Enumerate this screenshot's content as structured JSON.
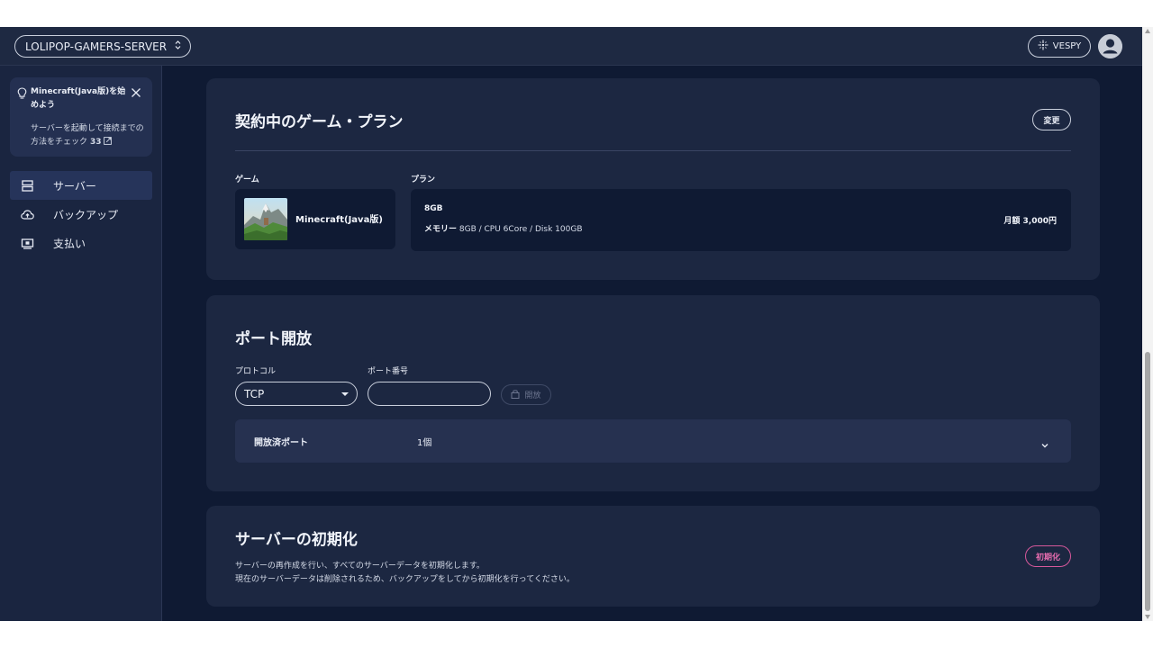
{
  "topbar": {
    "server_name": "LOLIPOP-GAMERS-SERVER",
    "user_button_label": "VESPY",
    "icons": {
      "server_select": "updown-chevron-icon",
      "user_button": "sparkle-icon",
      "avatar": "user-avatar-icon"
    }
  },
  "sidebar": {
    "tip": {
      "title": "Minecraft(Java版)を始めよう",
      "body": "サーバーを起動して接続までの方法をチェック",
      "link_badge": "33",
      "icons": {
        "bulb": "lightbulb-icon",
        "close": "close-icon",
        "link": "external-link-icon"
      }
    },
    "items": [
      {
        "label": "サーバー",
        "icon": "server-icon",
        "active": true
      },
      {
        "label": "バックアップ",
        "icon": "cloud-upload-icon",
        "active": false
      },
      {
        "label": "支払い",
        "icon": "payment-icon",
        "active": false
      }
    ]
  },
  "plan_card": {
    "title": "契約中のゲーム・プラン",
    "change_button": "変更",
    "game_label": "ゲーム",
    "plan_label": "プラン",
    "game_name": "Minecraft(Java版)",
    "plan_name": "8GB",
    "plan_spec_key": "メモリー",
    "plan_spec": "8GB / CPU 6Core / Disk 100GB",
    "price": "月額 3,000円"
  },
  "port_card": {
    "title": "ポート開放",
    "protocol_label": "プロトコル",
    "port_label": "ポート番号",
    "protocol_value": "TCP",
    "port_value": "",
    "open_button": "開放",
    "opened_ports_label": "開放済ポート",
    "opened_ports_count": "1個",
    "icons": {
      "open_button": "lock-icon",
      "accordion": "chevron-down-icon",
      "select": "caret-down-icon"
    }
  },
  "reset_card": {
    "title": "サーバーの初期化",
    "description_line1": "サーバーの再作成を行い、すべてのサーバーデータを初期化します。",
    "description_line2": "現在のサーバーデータは削除されるため、バックアップをしてから初期化を行ってください。",
    "reset_button": "初期化"
  },
  "colors": {
    "background": "#0f1a33",
    "surface": "#1c2741",
    "sidebar": "#1a2540",
    "topbar": "#1e2942",
    "active_nav": "#26345a",
    "danger": "#e56cae"
  }
}
